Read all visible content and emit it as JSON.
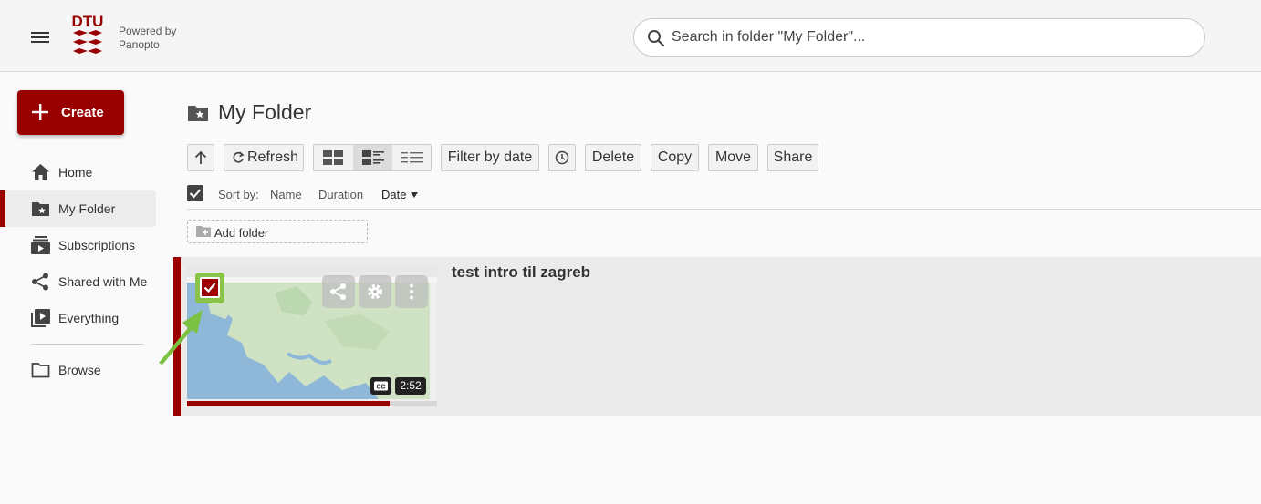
{
  "header": {
    "logo_text": "DTU",
    "powered_line1": "Powered by",
    "powered_line2": "Panopto",
    "search_placeholder": "Search in folder \"My Folder\"..."
  },
  "sidebar": {
    "create_label": "Create",
    "items": [
      {
        "label": "Home",
        "icon": "home-icon"
      },
      {
        "label": "My Folder",
        "icon": "folder-star-icon",
        "active": true
      },
      {
        "label": "Subscriptions",
        "icon": "subscriptions-icon"
      },
      {
        "label": "Shared with Me",
        "icon": "share-icon"
      },
      {
        "label": "Everything",
        "icon": "library-play-icon"
      },
      {
        "label": "Browse",
        "icon": "folder-outline-icon"
      }
    ]
  },
  "main": {
    "title": "My Folder",
    "toolbar": {
      "refresh": "Refresh",
      "filter_by_date": "Filter by date",
      "delete": "Delete",
      "copy": "Copy",
      "move": "Move",
      "share": "Share"
    },
    "sort": {
      "label": "Sort by:",
      "options": [
        "Name",
        "Duration",
        "Date"
      ],
      "active": "Date"
    },
    "add_folder": "Add folder",
    "sessions": [
      {
        "title": "test intro til zagreb",
        "duration": "2:52",
        "has_captions": true,
        "progress": 0.81,
        "selected": true
      }
    ]
  },
  "colors": {
    "brand": "#990000",
    "highlight": "#8bc34a"
  }
}
